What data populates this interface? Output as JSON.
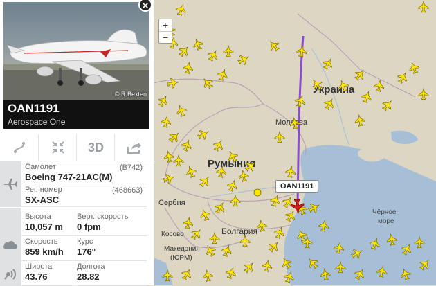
{
  "photo": {
    "credit": "© R.Bexten"
  },
  "flight": {
    "callsign": "OAN1191",
    "airline": "Aerospace One"
  },
  "toolbar": {
    "view_3d": "3D"
  },
  "details": {
    "aircraft_label": "Самолет",
    "aircraft_code": "(B742)",
    "aircraft_value": "Boeing 747-21AC(M)",
    "reg_label": "Рег. номер",
    "reg_code": "(468663)",
    "reg_value": "SX-ASC",
    "alt_label": "Высота",
    "alt_value": "10,057 m",
    "vspeed_label": "Верт. скорость",
    "vspeed_value": "0 fpm",
    "speed_label": "Скорость",
    "speed_value": "859 km/h",
    "course_label": "Курс",
    "course_value": "176°",
    "lat_label": "Широта",
    "lat_value": "43.76",
    "lon_label": "Долгота",
    "lon_value": "28.82"
  },
  "map": {
    "zoom_in": "+",
    "zoom_out": "−",
    "flight_label": "OAN1191",
    "labels": {
      "ukraine": "Украина",
      "moldova": "Молдова",
      "romania": "Румыния",
      "serbia": "Сербия",
      "bulgaria": "Болгария",
      "kosovo": "Косово",
      "macedonia1": "Македония",
      "macedonia2": "(ЮРМ)",
      "black_sea1": "Чёрное",
      "black_sea2": "море"
    },
    "colors": {
      "land": "#dcd6c2",
      "sea": "#a6bfd6",
      "track": "#8a4dcf",
      "plane": "#ffe600",
      "selected": "#d81e1e"
    }
  }
}
